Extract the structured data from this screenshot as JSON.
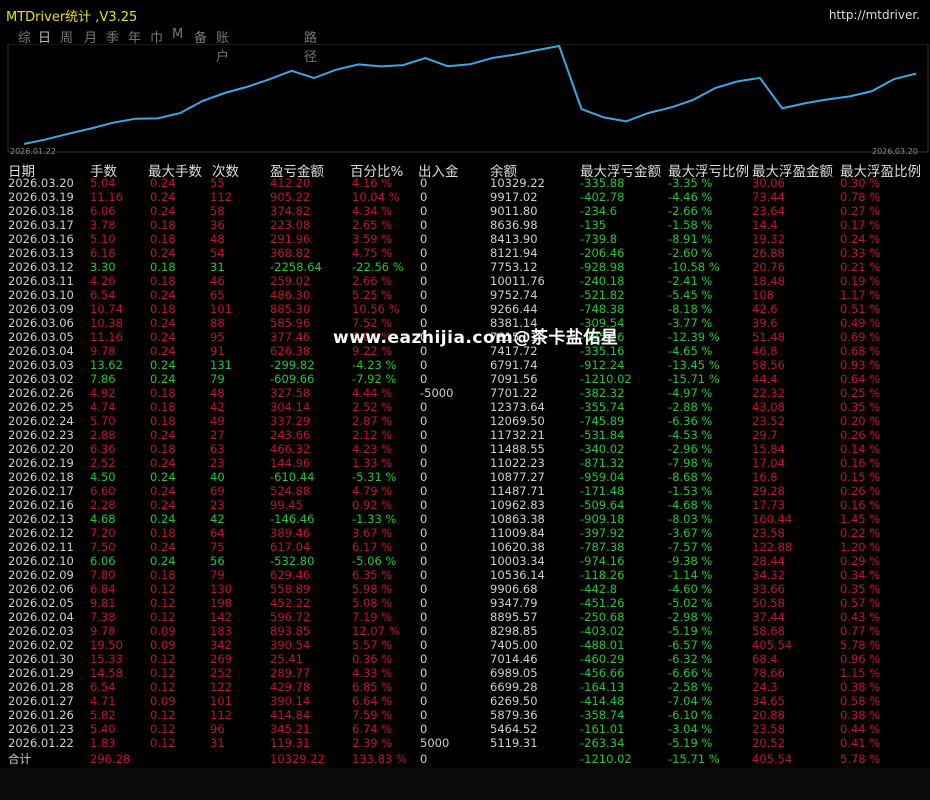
{
  "app": {
    "title": "MTDriver统计 ,V3.25",
    "url": "http://mtdriver."
  },
  "tabs": [
    "综",
    "日",
    "周",
    "月",
    "季",
    "年",
    "巾",
    "M",
    "备",
    "账户",
    "路径"
  ],
  "chart_data": {
    "type": "line",
    "x_start": "2026.01.22",
    "x_end": "2026.03.20",
    "series": [
      {
        "values": [
          5119.31,
          5464.52,
          5879.36,
          6269.5,
          6699.28,
          6989.05,
          7014.46,
          7405.0,
          8298.85,
          8895.57,
          9347.79,
          9906.68,
          10536.14,
          10003.34,
          10620.38,
          11009.84,
          10863.38,
          10962.83,
          11487.71,
          10877.27,
          11022.23,
          11488.55,
          11732.21,
          12069.5,
          12373.64,
          7701.22,
          7091.56,
          6791.74,
          7417.72,
          7815.01,
          8381.14,
          9266.44,
          9752.74,
          10011.76,
          7753.12,
          8121.94,
          8413.9,
          8636.98,
          9011.8,
          9917.02,
          10329.22
        ]
      }
    ]
  },
  "headers": {
    "date": "日期",
    "lots": "手数",
    "max_lots": "最大手数",
    "trades": "次数",
    "pnl": "盈亏金额",
    "pct": "百分比%",
    "io": "出入金",
    "balance": "余额",
    "max_float_loss": "最大浮亏金额",
    "max_float_loss_pct": "最大浮亏比例",
    "max_float_profit": "最大浮盈金额",
    "max_float_profit_pct": "最大浮盈比例"
  },
  "rows": [
    {
      "d": "2026.03.20",
      "lots": "5.04",
      "max": "0.24",
      "n": "55",
      "pnl": "412.20",
      "pct": "4.16 %",
      "io": "0",
      "bal": "10329.22",
      "mfl": "-335.88",
      "mflp": "-3.35 %",
      "mfp": "30.06",
      "mfpp": "0.30 %",
      "win": false
    },
    {
      "d": "2026.03.19",
      "lots": "11.16",
      "max": "0.24",
      "n": "112",
      "pnl": "905.22",
      "pct": "10.04 %",
      "io": "0",
      "bal": "9917.02",
      "mfl": "-402.78",
      "mflp": "-4.46 %",
      "mfp": "73.44",
      "mfpp": "0.78 %",
      "win": false
    },
    {
      "d": "2026.03.18",
      "lots": "6.06",
      "max": "0.24",
      "n": "58",
      "pnl": "374.82",
      "pct": "4.34 %",
      "io": "0",
      "bal": "9011.80",
      "mfl": "-234.6",
      "mflp": "-2.66 %",
      "mfp": "23.64",
      "mfpp": "0.27 %",
      "win": false
    },
    {
      "d": "2026.03.17",
      "lots": "3.78",
      "max": "0.18",
      "n": "36",
      "pnl": "223.08",
      "pct": "2.65 %",
      "io": "0",
      "bal": "8636.98",
      "mfl": "-135",
      "mflp": "-1.58 %",
      "mfp": "14.4",
      "mfpp": "0.17 %",
      "win": false
    },
    {
      "d": "2026.03.16",
      "lots": "5.10",
      "max": "0.18",
      "n": "48",
      "pnl": "291.96",
      "pct": "3.59 %",
      "io": "0",
      "bal": "8413.90",
      "mfl": "-739.8",
      "mflp": "-8.91 %",
      "mfp": "19.32",
      "mfpp": "0.24 %",
      "win": false
    },
    {
      "d": "2026.03.13",
      "lots": "6.18",
      "max": "0.24",
      "n": "54",
      "pnl": "368.82",
      "pct": "4.75 %",
      "io": "0",
      "bal": "8121.94",
      "mfl": "-206.46",
      "mflp": "-2.60 %",
      "mfp": "26.88",
      "mfpp": "0.33 %",
      "win": false
    },
    {
      "d": "2026.03.12",
      "lots": "3.30",
      "max": "0.18",
      "n": "31",
      "pnl": "-2258.64",
      "pct": "-22.56 %",
      "io": "0",
      "bal": "7753.12",
      "mfl": "-928.98",
      "mflp": "-10.58 %",
      "mfp": "20.76",
      "mfpp": "0.21 %",
      "win": true
    },
    {
      "d": "2026.03.11",
      "lots": "4.26",
      "max": "0.18",
      "n": "46",
      "pnl": "259.02",
      "pct": "2.66 %",
      "io": "0",
      "bal": "10011.76",
      "mfl": "-240.18",
      "mflp": "-2.41 %",
      "mfp": "18.48",
      "mfpp": "0.19 %",
      "win": false
    },
    {
      "d": "2026.03.10",
      "lots": "6.54",
      "max": "0.24",
      "n": "65",
      "pnl": "486.30",
      "pct": "5.25 %",
      "io": "0",
      "bal": "9752.74",
      "mfl": "-521.82",
      "mflp": "-5.45 %",
      "mfp": "108",
      "mfpp": "1.17 %",
      "win": false
    },
    {
      "d": "2026.03.09",
      "lots": "10.74",
      "max": "0.18",
      "n": "101",
      "pnl": "885.30",
      "pct": "10.56 %",
      "io": "0",
      "bal": "9266.44",
      "mfl": "-748.38",
      "mflp": "-8.18 %",
      "mfp": "42.6",
      "mfpp": "0.51 %",
      "win": false
    },
    {
      "d": "2026.03.06",
      "lots": "10.38",
      "max": "0.24",
      "n": "88",
      "pnl": "585.96",
      "pct": "7.52 %",
      "io": "0",
      "bal": "8381.14",
      "mfl": "-309.54",
      "mflp": "-3.77 %",
      "mfp": "39.6",
      "mfpp": "0.49 %",
      "win": false
    },
    {
      "d": "2026.03.05",
      "lots": "11.16",
      "max": "0.24",
      "n": "95",
      "pnl": "377.46",
      "pct": "5.04 %",
      "io": "0",
      "bal": "7815.01",
      "mfl": "-985.26",
      "mflp": "-12.39 %",
      "mfp": "51.48",
      "mfpp": "0.69 %",
      "win": false
    },
    {
      "d": "2026.03.04",
      "lots": "9.78",
      "max": "0.24",
      "n": "91",
      "pnl": "626.38",
      "pct": "9.22 %",
      "io": "0",
      "bal": "7417.72",
      "mfl": "-335.16",
      "mflp": "-4.65 %",
      "mfp": "46.8",
      "mfpp": "0.68 %",
      "win": false
    },
    {
      "d": "2026.03.03",
      "lots": "13.62",
      "max": "0.24",
      "n": "131",
      "pnl": "-299.82",
      "pct": "-4.23 %",
      "io": "0",
      "bal": "6791.74",
      "mfl": "-912.24",
      "mflp": "-13.45 %",
      "mfp": "58.56",
      "mfpp": "0.93 %",
      "win": true
    },
    {
      "d": "2026.03.02",
      "lots": "7.86",
      "max": "0.24",
      "n": "79",
      "pnl": "-609.66",
      "pct": "-7.92 %",
      "io": "0",
      "bal": "7091.56",
      "mfl": "-1210.02",
      "mflp": "-15.71 %",
      "mfp": "44.4",
      "mfpp": "0.64 %",
      "win": true
    },
    {
      "d": "2026.02.26",
      "lots": "4.92",
      "max": "0.18",
      "n": "48",
      "pnl": "327.58",
      "pct": "4.44 %",
      "io": "-5000",
      "bal": "7701.22",
      "mfl": "-382.32",
      "mflp": "-4.97 %",
      "mfp": "22.32",
      "mfpp": "0.25 %",
      "win": false
    },
    {
      "d": "2026.02.25",
      "lots": "4.74",
      "max": "0.18",
      "n": "42",
      "pnl": "304.14",
      "pct": "2.52 %",
      "io": "0",
      "bal": "12373.64",
      "mfl": "-355.74",
      "mflp": "-2.88 %",
      "mfp": "43.08",
      "mfpp": "0.35 %",
      "win": false
    },
    {
      "d": "2026.02.24",
      "lots": "5.70",
      "max": "0.18",
      "n": "49",
      "pnl": "337.29",
      "pct": "2.87 %",
      "io": "0",
      "bal": "12069.50",
      "mfl": "-745.89",
      "mflp": "-6.36 %",
      "mfp": "23.52",
      "mfpp": "0.20 %",
      "win": false
    },
    {
      "d": "2026.02.23",
      "lots": "2.88",
      "max": "0.24",
      "n": "27",
      "pnl": "243.66",
      "pct": "2.12 %",
      "io": "0",
      "bal": "11732.21",
      "mfl": "-531.84",
      "mflp": "-4.53 %",
      "mfp": "29.7",
      "mfpp": "0.26 %",
      "win": false
    },
    {
      "d": "2026.02.20",
      "lots": "6.36",
      "max": "0.18",
      "n": "63",
      "pnl": "466.32",
      "pct": "4.23 %",
      "io": "0",
      "bal": "11488.55",
      "mfl": "-340.02",
      "mflp": "-2.96 %",
      "mfp": "15.84",
      "mfpp": "0.14 %",
      "win": false
    },
    {
      "d": "2026.02.19",
      "lots": "2.52",
      "max": "0.24",
      "n": "23",
      "pnl": "144.96",
      "pct": "1.33 %",
      "io": "0",
      "bal": "11022.23",
      "mfl": "-871.32",
      "mflp": "-7.98 %",
      "mfp": "17.04",
      "mfpp": "0.16 %",
      "win": false
    },
    {
      "d": "2026.02.18",
      "lots": "4.50",
      "max": "0.24",
      "n": "40",
      "pnl": "-610.44",
      "pct": "-5.31 %",
      "io": "0",
      "bal": "10877.27",
      "mfl": "-959.04",
      "mflp": "-8.68 %",
      "mfp": "16.8",
      "mfpp": "0.15 %",
      "win": true
    },
    {
      "d": "2026.02.17",
      "lots": "6.60",
      "max": "0.24",
      "n": "69",
      "pnl": "524.88",
      "pct": "4.79 %",
      "io": "0",
      "bal": "11487.71",
      "mfl": "-171.48",
      "mflp": "-1.53 %",
      "mfp": "29.28",
      "mfpp": "0.26 %",
      "win": false
    },
    {
      "d": "2026.02.16",
      "lots": "2.28",
      "max": "0.24",
      "n": "23",
      "pnl": "99.45",
      "pct": "0.92 %",
      "io": "0",
      "bal": "10962.83",
      "mfl": "-509.64",
      "mflp": "-4.68 %",
      "mfp": "17.73",
      "mfpp": "0.16 %",
      "win": false
    },
    {
      "d": "2026.02.13",
      "lots": "4.68",
      "max": "0.24",
      "n": "42",
      "pnl": "-146.46",
      "pct": "-1.33 %",
      "io": "0",
      "bal": "10863.38",
      "mfl": "-909.18",
      "mflp": "-8.03 %",
      "mfp": "160.44",
      "mfpp": "1.45 %",
      "win": true
    },
    {
      "d": "2026.02.12",
      "lots": "7.20",
      "max": "0.18",
      "n": "64",
      "pnl": "389.46",
      "pct": "3.67 %",
      "io": "0",
      "bal": "11009.84",
      "mfl": "-397.92",
      "mflp": "-3.67 %",
      "mfp": "23.58",
      "mfpp": "0.22 %",
      "win": false
    },
    {
      "d": "2026.02.11",
      "lots": "7.50",
      "max": "0.24",
      "n": "75",
      "pnl": "617.04",
      "pct": "6.17 %",
      "io": "0",
      "bal": "10620.38",
      "mfl": "-787.38",
      "mflp": "-7.57 %",
      "mfp": "122.88",
      "mfpp": "1.20 %",
      "win": false
    },
    {
      "d": "2026.02.10",
      "lots": "6.06",
      "max": "0.24",
      "n": "56",
      "pnl": "-532.80",
      "pct": "-5.06 %",
      "io": "0",
      "bal": "10003.34",
      "mfl": "-974.16",
      "mflp": "-9.38 %",
      "mfp": "28.44",
      "mfpp": "0.29 %",
      "win": true
    },
    {
      "d": "2026.02.09",
      "lots": "7.80",
      "max": "0.18",
      "n": "79",
      "pnl": "629.46",
      "pct": "6.35 %",
      "io": "0",
      "bal": "10536.14",
      "mfl": "-118.26",
      "mflp": "-1.14 %",
      "mfp": "34.32",
      "mfpp": "0.34 %",
      "win": false
    },
    {
      "d": "2026.02.06",
      "lots": "6.84",
      "max": "0.12",
      "n": "130",
      "pnl": "558.89",
      "pct": "5.98 %",
      "io": "0",
      "bal": "9906.68",
      "mfl": "-442.8",
      "mflp": "-4.60 %",
      "mfp": "33.66",
      "mfpp": "0.35 %",
      "win": false
    },
    {
      "d": "2026.02.05",
      "lots": "9.81",
      "max": "0.12",
      "n": "198",
      "pnl": "452.22",
      "pct": "5.08 %",
      "io": "0",
      "bal": "9347.79",
      "mfl": "-451.26",
      "mflp": "-5.02 %",
      "mfp": "50.58",
      "mfpp": "0.57 %",
      "win": false
    },
    {
      "d": "2026.02.04",
      "lots": "7.38",
      "max": "0.12",
      "n": "142",
      "pnl": "596.72",
      "pct": "7.19 %",
      "io": "0",
      "bal": "8895.57",
      "mfl": "-250.68",
      "mflp": "-2.98 %",
      "mfp": "37.44",
      "mfpp": "0.43 %",
      "win": false
    },
    {
      "d": "2026.02.03",
      "lots": "9.78",
      "max": "0.09",
      "n": "183",
      "pnl": "893.85",
      "pct": "12.07 %",
      "io": "0",
      "bal": "8298.85",
      "mfl": "-403.02",
      "mflp": "-5.19 %",
      "mfp": "58.68",
      "mfpp": "0.77 %",
      "win": false
    },
    {
      "d": "2026.02.02",
      "lots": "19.50",
      "max": "0.09",
      "n": "342",
      "pnl": "390.54",
      "pct": "5.57 %",
      "io": "0",
      "bal": "7405.00",
      "mfl": "-488.01",
      "mflp": "-6.57 %",
      "mfp": "405.54",
      "mfpp": "5.78 %",
      "win": false
    },
    {
      "d": "2026.01.30",
      "lots": "15.33",
      "max": "0.12",
      "n": "269",
      "pnl": "25.41",
      "pct": "0.36 %",
      "io": "0",
      "bal": "7014.46",
      "mfl": "-460.29",
      "mflp": "-6.32 %",
      "mfp": "68.4",
      "mfpp": "0.96 %",
      "win": false
    },
    {
      "d": "2026.01.29",
      "lots": "14.58",
      "max": "0.12",
      "n": "252",
      "pnl": "289.77",
      "pct": "4.33 %",
      "io": "0",
      "bal": "6989.05",
      "mfl": "-456.66",
      "mflp": "-6.66 %",
      "mfp": "78.66",
      "mfpp": "1.15 %",
      "win": false
    },
    {
      "d": "2026.01.28",
      "lots": "6.54",
      "max": "0.12",
      "n": "122",
      "pnl": "429.78",
      "pct": "6.85 %",
      "io": "0",
      "bal": "6699.28",
      "mfl": "-164.13",
      "mflp": "-2.58 %",
      "mfp": "24.3",
      "mfpp": "0.38 %",
      "win": false
    },
    {
      "d": "2026.01.27",
      "lots": "4.71",
      "max": "0.09",
      "n": "101",
      "pnl": "390.14",
      "pct": "6.64 %",
      "io": "0",
      "bal": "6269.50",
      "mfl": "-414.48",
      "mflp": "-7.04 %",
      "mfp": "34.65",
      "mfpp": "0.58 %",
      "win": false
    },
    {
      "d": "2026.01.26",
      "lots": "5.82",
      "max": "0.12",
      "n": "112",
      "pnl": "414.84",
      "pct": "7.59 %",
      "io": "0",
      "bal": "5879.36",
      "mfl": "-358.74",
      "mflp": "-6.10 %",
      "mfp": "20.88",
      "mfpp": "0.38 %",
      "win": false
    },
    {
      "d": "2026.01.23",
      "lots": "5.40",
      "max": "0.12",
      "n": "96",
      "pnl": "345.21",
      "pct": "6.74 %",
      "io": "0",
      "bal": "5464.52",
      "mfl": "-161.01",
      "mflp": "-3.04 %",
      "mfp": "23.58",
      "mfpp": "0.44 %",
      "win": false
    },
    {
      "d": "2026.01.22",
      "lots": "1.83",
      "max": "0.12",
      "n": "31",
      "pnl": "119.31",
      "pct": "2.39 %",
      "io": "5000",
      "bal": "5119.31",
      "mfl": "-263.34",
      "mflp": "-5.19 %",
      "mfp": "20.52",
      "mfpp": "0.41 %",
      "win": false
    }
  ],
  "total": {
    "label": "合计",
    "lots": "296.28",
    "pnl": "10329.22",
    "pct": "133.83 %",
    "io": "0",
    "mfl": "-1210.02",
    "mflp": "-15.71 %",
    "mfp": "405.54",
    "mfpp": "5.78 %"
  },
  "watermark": "www.eazhijia.com@茶卡盐佑星"
}
